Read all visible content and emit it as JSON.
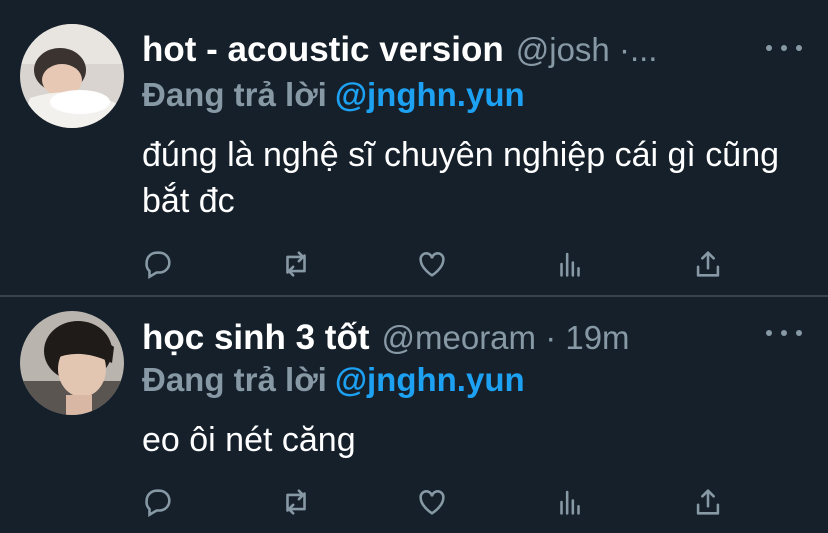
{
  "tweets": [
    {
      "display_name": "hot - acoustic version",
      "handle_meta": "@josh ·...",
      "reply_prefix": "Đang trả lời",
      "reply_mention": "@jnghn.yun",
      "text": "đúng là nghệ sĩ chuyên nghiệp cái gì cũng bắt đc"
    },
    {
      "display_name": "học sinh 3 tốt",
      "handle_meta": "@meoram · 19m",
      "reply_prefix": "Đang trả lời",
      "reply_mention": "@jnghn.yun",
      "text": "eo ôi nét căng"
    }
  ],
  "actions": [
    "reply-icon",
    "retweet-icon",
    "like-icon",
    "analytics-icon",
    "share-icon"
  ],
  "colors": {
    "background": "#15202b",
    "secondary_text": "#8899a6",
    "accent": "#1da1f2",
    "divider": "#38444d"
  }
}
